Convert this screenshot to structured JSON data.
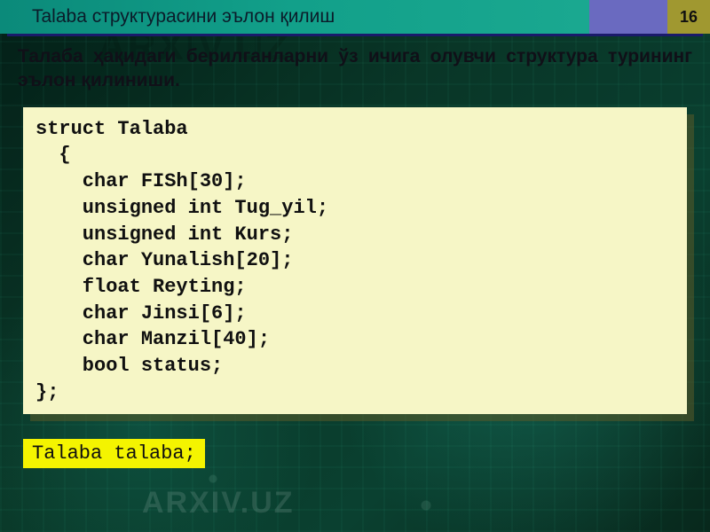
{
  "header": {
    "title": "Talaba структурасини эълон қилиш",
    "page_number": "16"
  },
  "subtitle": "Талаба ҳақидаги берилганларни ўз ичига олувчи структура турининг эълон қилиниши.",
  "code": "struct Talaba\n  {\n    char FISh[30];\n    unsigned int Tug_yil;\n    unsigned int Kurs;\n    char Yunalish[20];\n    float Reyting;\n    char Jinsi[6];\n    char Manzil[40];\n    bool status;\n};",
  "declaration": "Talaba talaba;",
  "watermark": "ARXIV.UZ"
}
